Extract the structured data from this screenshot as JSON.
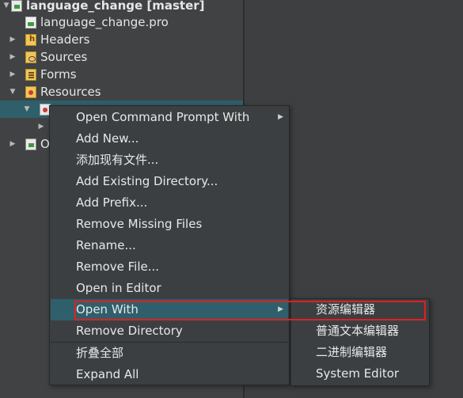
{
  "tree": {
    "rows": [
      {
        "label": "language_change [master]",
        "arrow": "▼",
        "icon": "proj",
        "bold": true
      },
      {
        "label": "language_change.pro",
        "arrow": "",
        "icon": "page"
      },
      {
        "label": "Headers",
        "arrow": "▶",
        "icon": "h"
      },
      {
        "label": "Sources",
        "arrow": "▶",
        "icon": "src"
      },
      {
        "label": "Forms",
        "arrow": "▶",
        "icon": "form"
      },
      {
        "label": "Resources",
        "arrow": "▼",
        "icon": "res"
      },
      {
        "label": "",
        "arrow": "▼",
        "icon": "qrc"
      },
      {
        "label": "",
        "arrow": "▶",
        "icon": ""
      },
      {
        "label": "O",
        "arrow": "▶",
        "icon": "proj"
      }
    ]
  },
  "context_menu": {
    "items": [
      {
        "label": "Open Command Prompt With",
        "submenu": true
      },
      {
        "label": "Add New...",
        "submenu": false
      },
      {
        "label": "添加现有文件...",
        "submenu": false
      },
      {
        "label": "Add Existing Directory...",
        "submenu": false
      },
      {
        "label": "Add Prefix...",
        "submenu": false
      },
      {
        "label": "Remove Missing Files",
        "submenu": false
      },
      {
        "label": "Rename...",
        "submenu": false
      },
      {
        "label": "Remove File...",
        "submenu": false
      },
      {
        "label": "Open in Editor",
        "submenu": false
      },
      {
        "label": "Open With",
        "submenu": true,
        "highlighted": true
      },
      {
        "label": "Remove Directory",
        "submenu": false
      },
      {
        "label": "折叠全部",
        "submenu": false
      },
      {
        "label": "Expand All",
        "submenu": false
      }
    ]
  },
  "open_with_submenu": {
    "items": [
      {
        "label": "资源编辑器"
      },
      {
        "label": "普通文本编辑器"
      },
      {
        "label": "二进制编辑器"
      },
      {
        "label": "System Editor"
      }
    ]
  },
  "colors": {
    "highlight": "#2f5f6a",
    "annotation_box": "#e02020",
    "background": "#404244"
  }
}
